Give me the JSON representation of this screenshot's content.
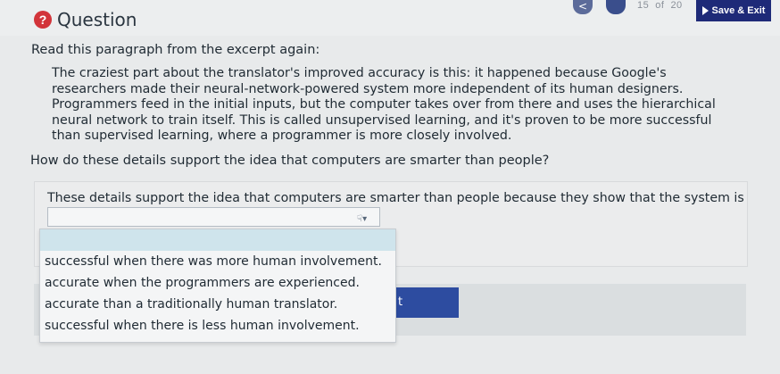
{
  "header": {
    "question_icon": "?",
    "title": "Question",
    "prev_icon": "<",
    "counter": {
      "current": "15",
      "of": "of",
      "total": "20"
    },
    "save_exit": "Save & Exit"
  },
  "content": {
    "instruction": "Read this paragraph from the excerpt again:",
    "excerpt": "The craziest part about the translator's improved accuracy is this: it happened because Google's researchers made their neural-network-powered system more independent of its human designers. Programmers feed in the initial inputs, but the computer takes over from there and uses the hierarchical neural network to train itself. This is called unsupervised learning, and it's proven to be more successful than supervised learning, where a programmer is more closely involved.",
    "question": "How do these details support the idea that computers are smarter than people?"
  },
  "answer": {
    "sentence_start": "These details support the idea that computers are smarter than people because they show that the system is more",
    "dropdown_icon": "pointer-cursor-icon",
    "options": [
      "successful when there was more human involvement.",
      "accurate when the programmers are experienced.",
      "accurate than a traditionally human translator.",
      "successful when there is less human involvement."
    ]
  },
  "partial_button_text": "t"
}
